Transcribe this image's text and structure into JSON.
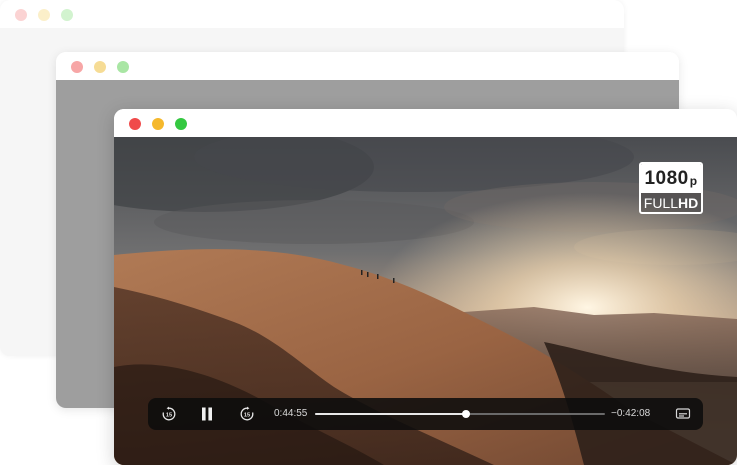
{
  "windows": {
    "back": {
      "dots": [
        "#fbd3d3",
        "#fbefc9",
        "#d2f3cf"
      ]
    },
    "middle": {
      "dots": [
        "#f7a6a6",
        "#f6dc95",
        "#a9e6a4"
      ]
    },
    "front": {
      "dots": [
        "#f04a4a",
        "#f5b82c",
        "#34c840"
      ]
    }
  },
  "badge": {
    "resolution": "1080",
    "suffix": "p",
    "label_light": "FULL",
    "label_bold": "HD"
  },
  "player": {
    "elapsed": "0:44:55",
    "remaining": "−0:42:08",
    "progress": 0.52,
    "controls": {
      "rewind": {
        "icon": "rewind-15-icon",
        "seconds": "15"
      },
      "play_pause": {
        "icon": "pause-icon"
      },
      "forward": {
        "icon": "forward-15-icon",
        "seconds": "15"
      },
      "subtitles": {
        "icon": "subtitles-icon"
      }
    }
  }
}
